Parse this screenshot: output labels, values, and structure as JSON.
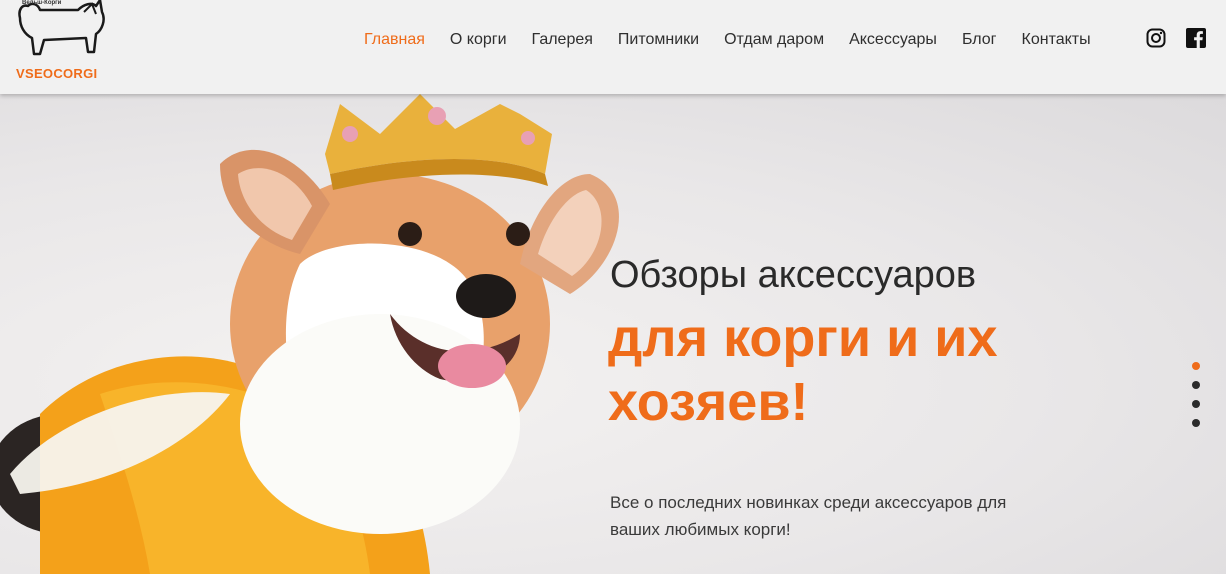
{
  "brand": {
    "name": "VSEOCORGI",
    "tagline": "Вельш-Корги"
  },
  "nav": {
    "items": [
      {
        "label": "Главная",
        "active": true
      },
      {
        "label": "О корги",
        "active": false
      },
      {
        "label": "Галерея",
        "active": false
      },
      {
        "label": "Питомники",
        "active": false
      },
      {
        "label": "Отдам даром",
        "active": false
      },
      {
        "label": "Аксессуары",
        "active": false
      },
      {
        "label": "Блог",
        "active": false
      },
      {
        "label": "Контакты",
        "active": false
      }
    ]
  },
  "social": [
    {
      "icon": "instagram-icon"
    },
    {
      "icon": "facebook-icon"
    }
  ],
  "hero": {
    "headline_line1": "Обзоры аксессуаров",
    "headline_line2": "для корги и их хозяев!",
    "subtext": "Все о последних новинках среди аксессуаров для ваших любимых корги!",
    "slides": {
      "count": 4,
      "active_index": 0
    }
  },
  "colors": {
    "accent": "#ef6c1a",
    "header_bg": "#f1f1f1",
    "text": "#2a2a2a"
  }
}
